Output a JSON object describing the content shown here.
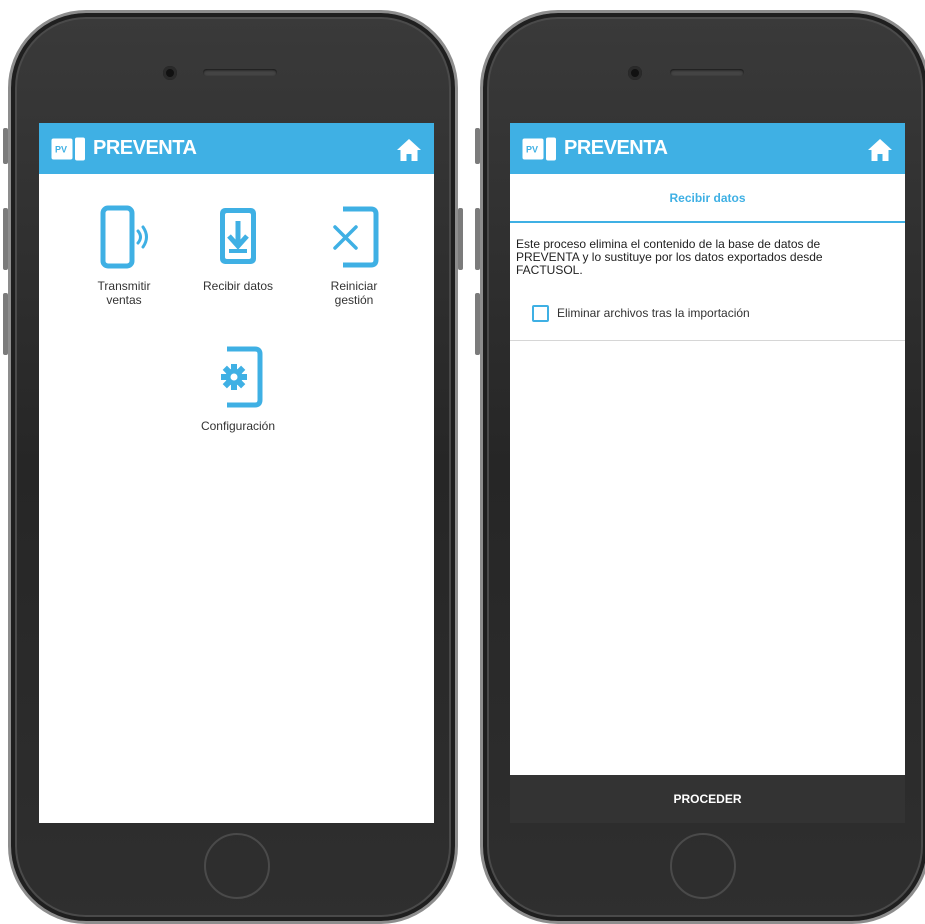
{
  "app": {
    "title": "PREVENTA",
    "accent_color": "#3fb0e4",
    "icons": {
      "logo": "preventa-logo-icon",
      "home": "home-icon"
    }
  },
  "menu": {
    "items": [
      {
        "label_line1": "Transmitir",
        "label_line2": "ventas",
        "icon": "phone-transmit-icon"
      },
      {
        "label": "Recibir datos",
        "icon": "download-icon"
      },
      {
        "label_line1": "Reiniciar",
        "label_line2": "gestión",
        "icon": "phone-reset-icon"
      },
      {
        "label": "Configuración",
        "icon": "phone-settings-icon"
      }
    ]
  },
  "recibir": {
    "header": "Recibir datos",
    "desc_line1": "Este proceso elimina el contenido de la base de datos de",
    "desc_line2": "PREVENTA y lo sustituye por los datos exportados desde",
    "desc_line3": "FACTUSOL.",
    "checkbox_label": "Eliminar archivos tras la importación",
    "checkbox_checked": false,
    "proceed_label": "PROCEDER"
  }
}
